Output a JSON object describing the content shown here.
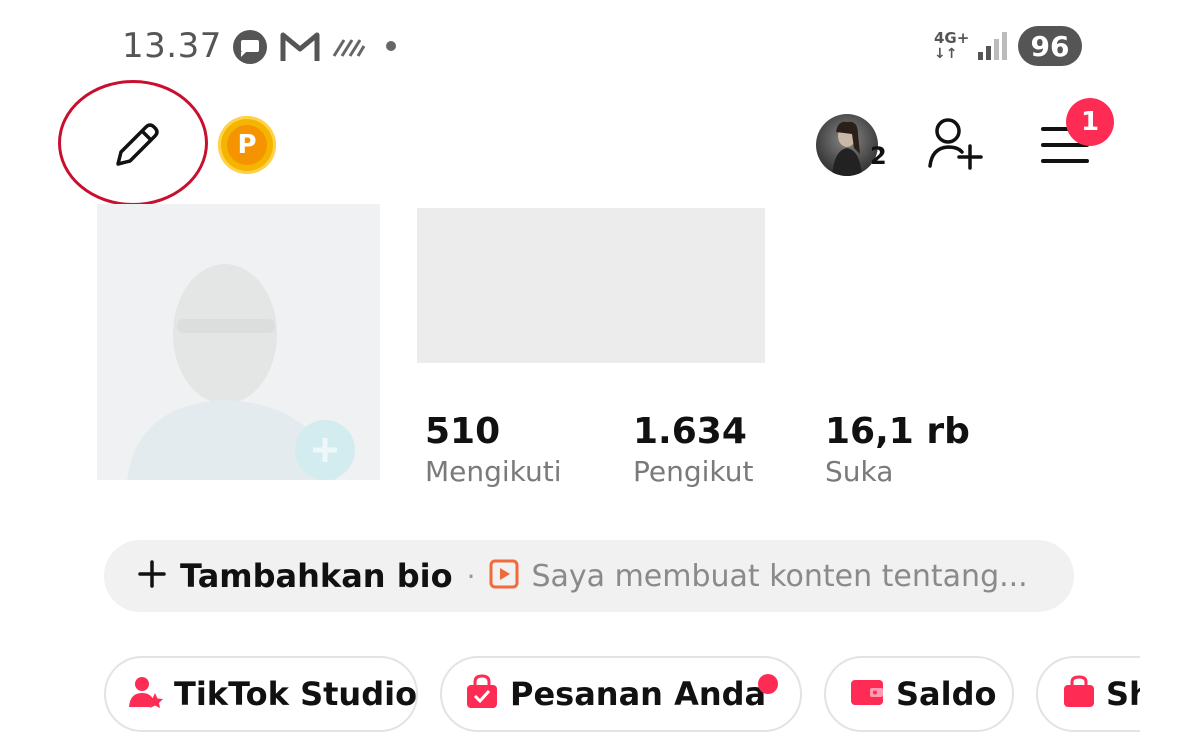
{
  "status_bar": {
    "time": "13.37",
    "network": "4G+",
    "battery": "96",
    "icons": [
      "message-icon",
      "gmail-icon",
      "signal-strike-icon",
      "dot-icon",
      "network-4g-icon",
      "signal-bars-icon",
      "battery-icon"
    ]
  },
  "header": {
    "left_icons": [
      "pencil-icon",
      "coin-p-icon"
    ],
    "coin_letter": "P",
    "account_count": "2",
    "menu_badge": "1",
    "right_icons": [
      "account-avatar",
      "add-user-icon",
      "menu-icon"
    ]
  },
  "profile": {
    "stats": [
      {
        "value": "510",
        "label": "Mengikuti"
      },
      {
        "value": "1.634",
        "label": "Pengikut"
      },
      {
        "value": "16,1 rb",
        "label": "Suka"
      }
    ]
  },
  "bio": {
    "add_label": "Tambahkan bio",
    "separator": "·",
    "content_text": "Saya membuat konten tentang..."
  },
  "chips": [
    {
      "label": "TikTok Studio",
      "icon": "studio-icon"
    },
    {
      "label": "Pesanan Anda",
      "icon": "orders-bag-icon",
      "badge": true
    },
    {
      "label": "Saldo",
      "icon": "wallet-icon"
    },
    {
      "label": "Sh",
      "icon": "shop-bag-icon"
    }
  ],
  "colors": {
    "accent": "#fe2c55",
    "annotation_circle": "#c8102e",
    "coin": "#f5b400",
    "chip_icon": "#fe2c55"
  }
}
